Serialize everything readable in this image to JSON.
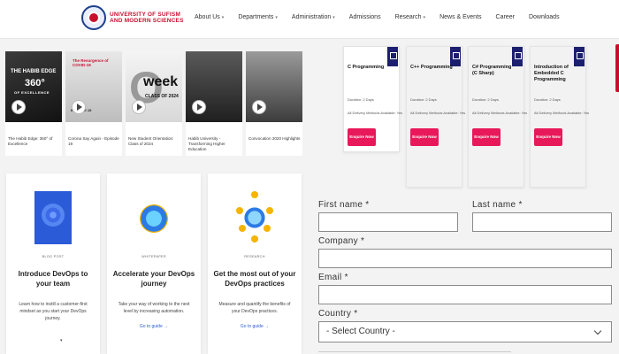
{
  "header": {
    "logo_line1": "UNIVERSITY OF SUFISM",
    "logo_line2": "AND MODERN SCIENCES",
    "nav": [
      {
        "label": "About Us",
        "dropdown": true
      },
      {
        "label": "Departments",
        "dropdown": true
      },
      {
        "label": "Administration",
        "dropdown": true
      },
      {
        "label": "Admissions",
        "dropdown": false
      },
      {
        "label": "Research",
        "dropdown": true
      },
      {
        "label": "News & Events",
        "dropdown": false
      },
      {
        "label": "Career",
        "dropdown": false
      },
      {
        "label": "Downloads",
        "dropdown": false
      }
    ]
  },
  "videos": [
    {
      "title": "The Habib Edge: 360° of Excellence",
      "overlay1": "THE HABIB EDGE",
      "overlay2": "360°",
      "overlay3": "OF EXCELLENCE"
    },
    {
      "title": "Corona Say Again - Episode 19",
      "overlay1": "The Resurgence of COVID-19",
      "overlay2": "EPISODE 19"
    },
    {
      "title": "New Student Orientation: Class of 2024",
      "overlay_big": "O",
      "overlay_week": "week",
      "overlay_sub": "CLASS OF 2024"
    },
    {
      "title": "Habib University - Transforming Higher Education"
    },
    {
      "title": "Convocation 2020 Highlights"
    }
  ],
  "courses": [
    {
      "title": "C Programming",
      "duration": "Duration: 2 Days",
      "delivery": "All Delivery Methods Available: Yes",
      "button": "Enquire Now"
    },
    {
      "title": "C++ Programming",
      "duration": "Duration: 2 Days",
      "delivery": "All Delivery Methods Available: Yes",
      "button": "Enquire Now"
    },
    {
      "title": "C# Programming (C Sharp)",
      "duration": "Duration: 2 Days",
      "delivery": "All Delivery Methods Available: Yes",
      "button": "Enquire Now"
    },
    {
      "title": "Introduction of Embedded C Programming",
      "duration": "Duration: 2 Days",
      "delivery": "All Delivery Methods Available: Yes",
      "button": "Enquire Now"
    }
  ],
  "devops": [
    {
      "tag": "BLOG POST",
      "title": "Introduce DevOps to your team",
      "desc": "Learn how to instill a customer-first mindset as you start your DevOps journey.",
      "link": ""
    },
    {
      "tag": "WHITEPAPER",
      "title": "Accelerate your DevOps journey",
      "desc": "Take your way of working to the next level by increasing automation.",
      "link": "Go to guide →"
    },
    {
      "tag": "RESEARCH",
      "title": "Get the most out of your DevOps practices",
      "desc": "Measure and quantify the benefits of your DevOps practices.",
      "link": "Go to guide →"
    }
  ],
  "form": {
    "first_name_label": "First name *",
    "last_name_label": "Last name *",
    "company_label": "Company *",
    "email_label": "Email *",
    "country_label": "Country *",
    "country_value": "- Select Country -"
  },
  "colors": {
    "brand_red": "#c8102e",
    "course_icon": "#1c1f6e",
    "enquire_button": "#e8195b",
    "link_blue": "#2c5bd8"
  }
}
